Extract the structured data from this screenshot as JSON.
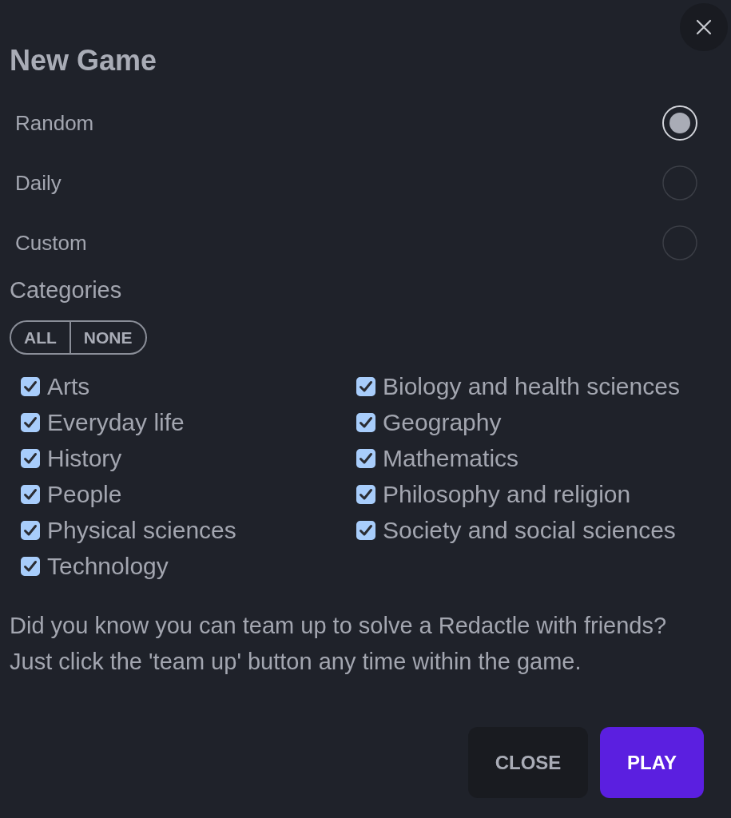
{
  "dialog": {
    "title": "New Game"
  },
  "modes": [
    {
      "label": "Random",
      "selected": true
    },
    {
      "label": "Daily",
      "selected": false
    },
    {
      "label": "Custom",
      "selected": false
    }
  ],
  "categories": {
    "heading": "Categories",
    "toggle_buttons": [
      "ALL",
      "NONE"
    ],
    "items": [
      {
        "label": "Arts",
        "checked": true
      },
      {
        "label": "Biology and health sciences",
        "checked": true
      },
      {
        "label": "Everyday life",
        "checked": true
      },
      {
        "label": "Geography",
        "checked": true
      },
      {
        "label": "History",
        "checked": true
      },
      {
        "label": "Mathematics",
        "checked": true
      },
      {
        "label": "People",
        "checked": true
      },
      {
        "label": "Philosophy and religion",
        "checked": true
      },
      {
        "label": "Physical sciences",
        "checked": true
      },
      {
        "label": "Society and social sciences",
        "checked": true
      },
      {
        "label": "Technology",
        "checked": true
      }
    ]
  },
  "tip": "Did you know you can team up to solve a Redactle with friends? Just click the 'team up' button any time within the game.",
  "buttons": [
    {
      "label": "CLOSE",
      "kind": "secondary"
    },
    {
      "label": "PLAY",
      "kind": "primary"
    }
  ]
}
